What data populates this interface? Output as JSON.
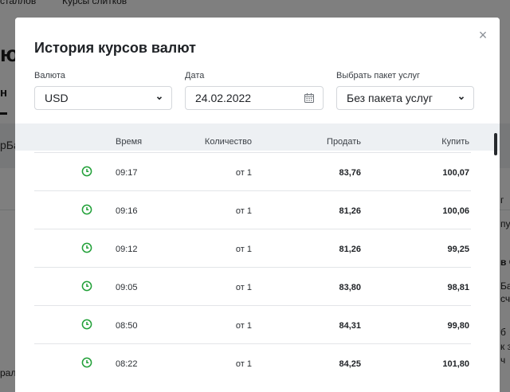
{
  "modal": {
    "title": "История курсов валют",
    "close_symbol": "×",
    "currency_label": "Валюта",
    "currency_value": "USD",
    "date_label": "Дата",
    "date_value": "24.02.2022",
    "package_label": "Выбрать пакет услуг",
    "package_value": "Без пакета услуг"
  },
  "table": {
    "headers": {
      "time": "Время",
      "quantity": "Количество",
      "sell": "Продать",
      "buy": "Купить"
    },
    "rows": [
      {
        "time": "09:17",
        "quantity": "от 1",
        "sell": "83,76",
        "buy": "100,07"
      },
      {
        "time": "09:16",
        "quantity": "от 1",
        "sell": "81,26",
        "buy": "100,06"
      },
      {
        "time": "09:12",
        "quantity": "от 1",
        "sell": "81,26",
        "buy": "99,25"
      },
      {
        "time": "09:05",
        "quantity": "от 1",
        "sell": "83,80",
        "buy": "98,81"
      },
      {
        "time": "08:50",
        "quantity": "от 1",
        "sell": "84,31",
        "buy": "99,80"
      },
      {
        "time": "08:22",
        "quantity": "от 1",
        "sell": "84,25",
        "buy": "101,80"
      }
    ]
  },
  "colors": {
    "accent_green": "#21a038",
    "overlay": "#7d7f83"
  },
  "icons": {
    "close": "close-icon",
    "chevron": "chevron-down-icon",
    "calendar": "calendar-icon",
    "clock": "clock-icon"
  }
}
